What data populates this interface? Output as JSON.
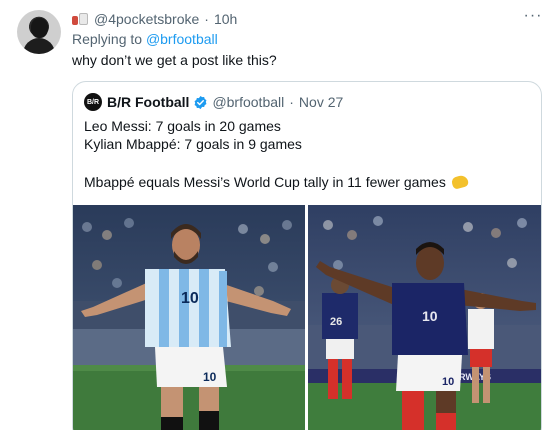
{
  "tweet": {
    "handle": "@4pocketsbroke",
    "separator": "·",
    "time": "10h",
    "more_label": "···",
    "replying_prefix": "Replying to ",
    "replying_to": "@brfootball",
    "text": "why don’t we get a post like this?"
  },
  "quote": {
    "logo_text": "B/R",
    "name": "B/R Football",
    "handle": "@brfootball",
    "separator": "·",
    "date": "Nov 27",
    "line1": "Leo Messi: 7 goals in 20 games",
    "line2": "Kylian Mbappé: 7 goals in 9 games",
    "line3": "Mbappé equals Messi’s World Cup tally in 11 fewer games"
  },
  "photos": {
    "left": {
      "jersey_number": "10"
    },
    "right": {
      "jersey_number": "10",
      "background_number": "26",
      "banner_text": "STAR AIRWAYS"
    }
  },
  "colors": {
    "link": "#1d9bf0",
    "secondary_text": "#536471",
    "border": "#cfd9de",
    "verified": "#1d9bf0"
  }
}
